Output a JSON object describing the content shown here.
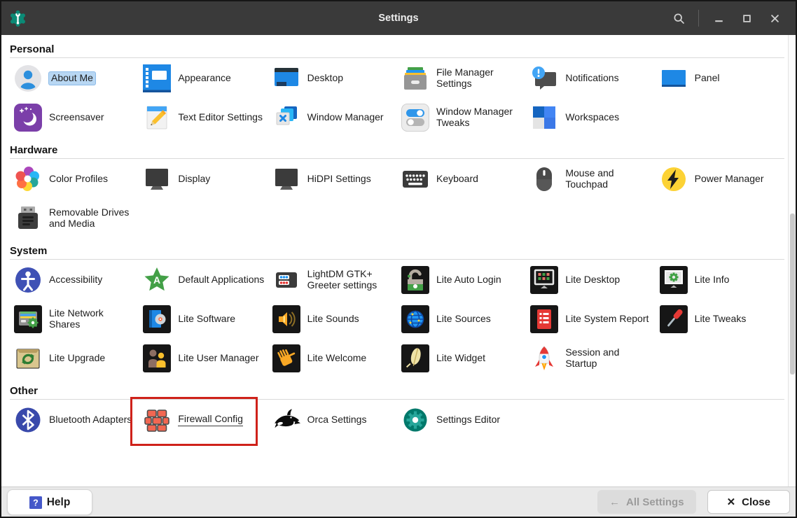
{
  "window": {
    "title": "Settings",
    "app_icon": "xfce-settings-logo",
    "controls": [
      "search",
      "minimize",
      "maximize",
      "close"
    ]
  },
  "sections": [
    {
      "title": "Personal",
      "items": [
        {
          "label": "About Me",
          "icon": "user",
          "selected": true
        },
        {
          "label": "Appearance",
          "icon": "appearance"
        },
        {
          "label": "Desktop",
          "icon": "desktop"
        },
        {
          "label": "File Manager Settings",
          "icon": "file-manager"
        },
        {
          "label": "Notifications",
          "icon": "notifications"
        },
        {
          "label": "Panel",
          "icon": "panel"
        },
        {
          "label": "Screensaver",
          "icon": "screensaver"
        },
        {
          "label": "Text Editor Settings",
          "icon": "text-editor"
        },
        {
          "label": "Window Manager",
          "icon": "window-manager"
        },
        {
          "label": "Window Manager Tweaks",
          "icon": "wm-tweaks"
        },
        {
          "label": "Workspaces",
          "icon": "workspaces"
        }
      ]
    },
    {
      "title": "Hardware",
      "items": [
        {
          "label": "Color Profiles",
          "icon": "color-profiles"
        },
        {
          "label": "Display",
          "icon": "display"
        },
        {
          "label": "HiDPI Settings",
          "icon": "hidpi"
        },
        {
          "label": "Keyboard",
          "icon": "keyboard"
        },
        {
          "label": "Mouse and Touchpad",
          "icon": "mouse"
        },
        {
          "label": "Power Manager",
          "icon": "power"
        },
        {
          "label": "Removable Drives and Media",
          "icon": "usb-drive"
        }
      ]
    },
    {
      "title": "System",
      "items": [
        {
          "label": "Accessibility",
          "icon": "accessibility"
        },
        {
          "label": "Default Applications",
          "icon": "default-apps"
        },
        {
          "label": "LightDM GTK+ Greeter settings",
          "icon": "lightdm"
        },
        {
          "label": "Lite Auto Login",
          "icon": "auto-login"
        },
        {
          "label": "Lite Desktop",
          "icon": "lite-desktop"
        },
        {
          "label": "Lite Info",
          "icon": "lite-info"
        },
        {
          "label": "Lite Network Shares",
          "icon": "network-shares"
        },
        {
          "label": "Lite Software",
          "icon": "software"
        },
        {
          "label": "Lite Sounds",
          "icon": "sounds"
        },
        {
          "label": "Lite Sources",
          "icon": "sources"
        },
        {
          "label": "Lite System Report",
          "icon": "system-report"
        },
        {
          "label": "Lite Tweaks",
          "icon": "tweaks"
        },
        {
          "label": "Lite Upgrade",
          "icon": "upgrade"
        },
        {
          "label": "Lite User Manager",
          "icon": "user-manager"
        },
        {
          "label": "Lite Welcome",
          "icon": "welcome"
        },
        {
          "label": "Lite Widget",
          "icon": "widget"
        },
        {
          "label": "Session and Startup",
          "icon": "session"
        }
      ]
    },
    {
      "title": "Other",
      "items": [
        {
          "label": "Bluetooth Adapters",
          "icon": "bluetooth"
        },
        {
          "label": "Firewall Config",
          "icon": "firewall",
          "annotated": true
        },
        {
          "label": "Orca Settings",
          "icon": "orca"
        },
        {
          "label": "Settings Editor",
          "icon": "settings-editor"
        }
      ]
    }
  ],
  "annotation": {
    "type": "highlight-box",
    "target": "Firewall Config",
    "color": "#cf221a"
  },
  "footer": {
    "help_label": "Help",
    "all_settings_glyph": "←",
    "all_settings_label": "All Settings",
    "all_settings_disabled": true,
    "close_glyph": "✕",
    "close_label": "Close"
  },
  "colors": {
    "titlebar": "#3a3a3a",
    "selection_highlight": "#b8d7f3",
    "annotation_box": "#cf221a",
    "footer_bg": "#e9e9e9"
  }
}
